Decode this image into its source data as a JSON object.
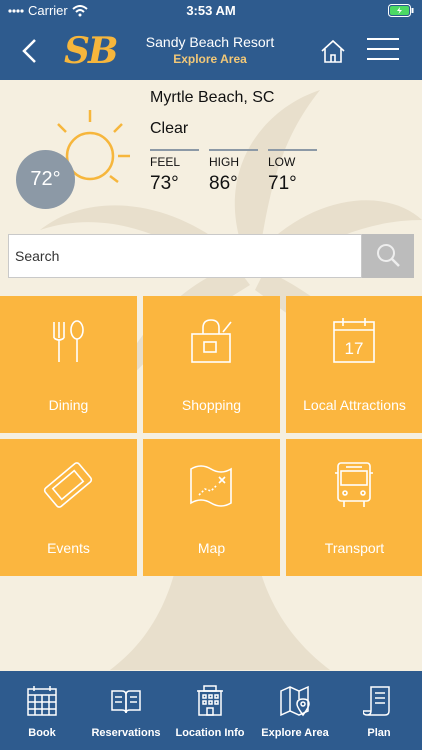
{
  "status_bar": {
    "carrier": "Carrier",
    "time": "3:53 AM"
  },
  "nav": {
    "title": "Sandy Beach Resort",
    "subtitle": "Explore Area",
    "logo": "SB"
  },
  "weather": {
    "location": "Myrtle Beach, SC",
    "condition": "Clear",
    "current_temp": "72°",
    "feel_label": "FEEL",
    "feel_value": "73°",
    "high_label": "HIGH",
    "high_value": "86°",
    "low_label": "LOW",
    "low_value": "71°"
  },
  "search": {
    "placeholder": "Search"
  },
  "tiles": [
    {
      "label": "Dining",
      "icon": "dining-icon"
    },
    {
      "label": "Shopping",
      "icon": "shopping-bag-icon"
    },
    {
      "label": "Local Attractions",
      "icon": "calendar-icon",
      "icon_text": "17"
    },
    {
      "label": "Events",
      "icon": "ticket-icon"
    },
    {
      "label": "Map",
      "icon": "map-icon"
    },
    {
      "label": "Transport",
      "icon": "bus-icon"
    }
  ],
  "tab_bar": [
    {
      "label": "Book",
      "icon": "calendar-grid-icon"
    },
    {
      "label": "Reservations",
      "icon": "book-icon"
    },
    {
      "label": "Location Info",
      "icon": "building-icon"
    },
    {
      "label": "Explore Area",
      "icon": "map-pin-icon"
    },
    {
      "label": "Plan",
      "icon": "scroll-icon"
    }
  ],
  "colors": {
    "primary": "#2e5b8e",
    "tile": "#fbb63f",
    "background": "#f5efe0",
    "accent": "#f6b63c",
    "temp_circle": "#8c99a6"
  }
}
